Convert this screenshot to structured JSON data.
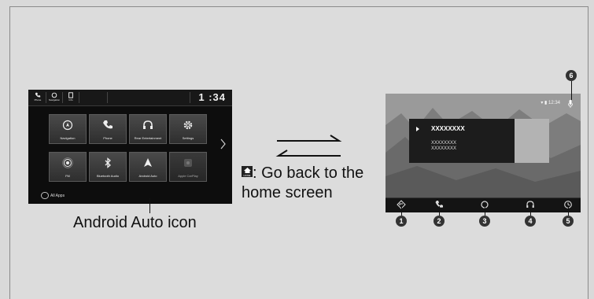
{
  "home_screen": {
    "status_buttons": [
      {
        "label": "Phone",
        "icon": "phone-icon"
      },
      {
        "label": "Navigation",
        "icon": "headset-icon"
      },
      {
        "label": "Info",
        "icon": "info-icon"
      }
    ],
    "clock": "1 :34",
    "tiles": [
      {
        "label": "Navigation",
        "icon": "compass-icon"
      },
      {
        "label": "Phone",
        "icon": "phone-icon"
      },
      {
        "label": "Rear Entertainment",
        "icon": "headphones-icon"
      },
      {
        "label": "Settings",
        "icon": "gear-icon"
      },
      {
        "label": "FM",
        "icon": "radio-icon"
      },
      {
        "label": "Bluetooth Audio",
        "icon": "bluetooth-icon"
      },
      {
        "label": "Android Auto",
        "icon": "android-auto-icon"
      },
      {
        "label": "Apple CarPlay",
        "icon": "carplay-icon"
      }
    ],
    "all_apps": "All Apps"
  },
  "callout": "Android Auto icon",
  "home_tip": {
    "key_caption": "HOME",
    "text": ": Go back to the home screen"
  },
  "android_auto": {
    "time": "12:34",
    "card": {
      "title": "XXXXXXXX",
      "line1": "XXXXXXXX",
      "line2": "XXXXXXXX"
    },
    "numbers": [
      "1",
      "2",
      "3",
      "4",
      "5",
      "6"
    ],
    "nav_icons": [
      "navigation-icon",
      "phone-icon",
      "home-circle-icon",
      "headphones-icon",
      "clock-icon"
    ]
  },
  "colors": {
    "page": "#d9d9d9",
    "screen": "#0d0d0d",
    "tile": "#3c3c3c",
    "aa_background": "#8f8f8f"
  }
}
